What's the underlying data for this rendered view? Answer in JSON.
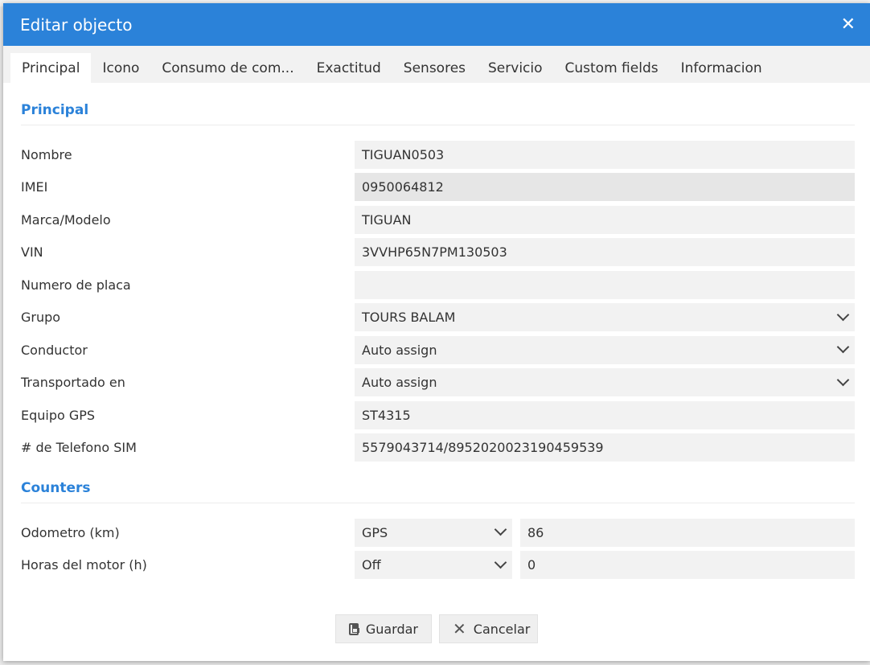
{
  "window": {
    "title": "Editar objecto",
    "close_icon": "close-icon"
  },
  "tabs": [
    {
      "label": "Principal",
      "active": true
    },
    {
      "label": "Icono",
      "active": false
    },
    {
      "label": "Consumo de com...",
      "active": false
    },
    {
      "label": "Exactitud",
      "active": false
    },
    {
      "label": "Sensores",
      "active": false
    },
    {
      "label": "Servicio",
      "active": false
    },
    {
      "label": "Custom fields",
      "active": false
    },
    {
      "label": "Informacion",
      "active": false
    }
  ],
  "principal": {
    "title": "Principal",
    "fields": [
      {
        "label": "Nombre",
        "value": "TIGUAN0503"
      },
      {
        "label": "IMEI",
        "value": "0950064812"
      },
      {
        "label": "Marca/Modelo",
        "value": "TIGUAN"
      },
      {
        "label": "VIN",
        "value": "3VVHP65N7PM130503"
      },
      {
        "label": "Numero de placa",
        "value": ""
      },
      {
        "label": "Grupo",
        "value": "TOURS BALAM"
      },
      {
        "label": "Conductor",
        "value": "Auto assign"
      },
      {
        "label": "Transportado en",
        "value": "Auto assign"
      },
      {
        "label": "Equipo GPS",
        "value": "ST4315"
      },
      {
        "label": "# de Telefono SIM",
        "value": "5579043714/8952020023190459539"
      }
    ]
  },
  "counters": {
    "title": "Counters",
    "odometer": {
      "label": "Odometro (km)",
      "source": "GPS",
      "value": "86"
    },
    "engine_hours": {
      "label": "Horas del motor (h)",
      "source": "Off",
      "value": "0"
    }
  },
  "actions": {
    "save_label": "Guardar",
    "cancel_label": "Cancelar"
  },
  "colors": {
    "accent": "#2b82d9"
  }
}
